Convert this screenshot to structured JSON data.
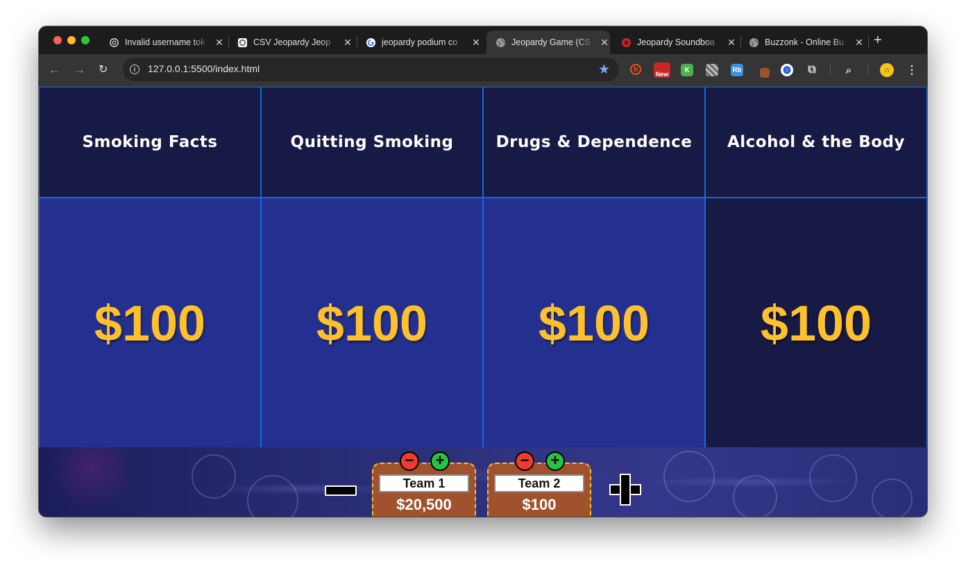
{
  "browser": {
    "tabs": [
      {
        "title": "Invalid username tok",
        "icon": "openai-icon",
        "active": false
      },
      {
        "title": "CSV Jeopardy Jeop",
        "icon": "openai-icon",
        "active": false
      },
      {
        "title": "jeopardy podium co",
        "icon": "google-icon",
        "active": false
      },
      {
        "title": "Jeopardy Game (CS",
        "icon": "globe-icon",
        "active": true
      },
      {
        "title": "Jeopardy Soundboa",
        "icon": "soundboard-icon",
        "active": false
      },
      {
        "title": "Buzzonk - Online Bu",
        "icon": "globe-icon",
        "active": false
      }
    ],
    "new_tab": "+",
    "url": "127.0.0.1:5500/index.html",
    "extensions": [
      {
        "name": "b-extension-icon",
        "label": "b",
        "color": "#e8541d"
      },
      {
        "name": "new-extension-icon",
        "label": "New",
        "color": "#c62828"
      },
      {
        "name": "k-extension-icon",
        "label": "K",
        "color": "#4caf50"
      },
      {
        "name": "qr-extension-icon",
        "label": "",
        "color": "#777777"
      },
      {
        "name": "rb-extension-icon",
        "label": "Rb",
        "color": "#3d8fe0"
      },
      {
        "name": "dropper-extension-icon",
        "label": "",
        "color": "#a0522d"
      },
      {
        "name": "password-extension-icon",
        "label": "",
        "color": "#1a5cd8"
      }
    ]
  },
  "game": {
    "categories": [
      "Smoking Facts",
      "Quitting Smoking",
      "Drugs & Dependence",
      "Alcohol & the Body"
    ],
    "values": [
      {
        "label": "$100",
        "answered": false
      },
      {
        "label": "$100",
        "answered": false
      },
      {
        "label": "$100",
        "answered": false
      },
      {
        "label": "$100",
        "answered": true
      }
    ],
    "colors": {
      "category_bg": "#161a45",
      "clue_bg": "#24308f",
      "value_text": "#ffc12b",
      "grid_line": "#1a6bd8",
      "podium": "#a0522d"
    },
    "teams": [
      {
        "name": "Team 1",
        "score": "$20,500",
        "minus": "−",
        "plus": "+"
      },
      {
        "name": "Team 2",
        "score": "$100",
        "minus": "−",
        "plus": "+"
      }
    ]
  }
}
